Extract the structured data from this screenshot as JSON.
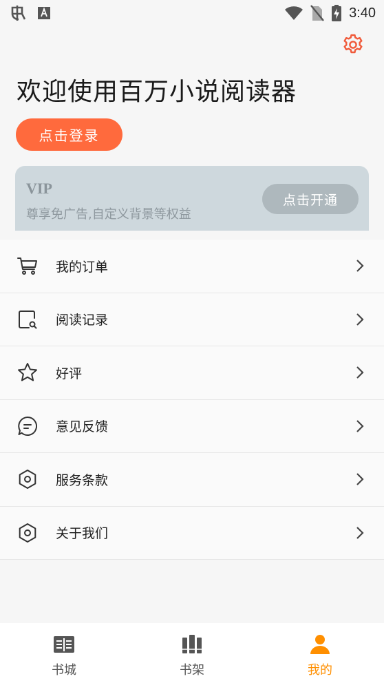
{
  "status_bar": {
    "time": "3:40"
  },
  "header": {
    "welcome_text": "欢迎使用百万小说阅读器",
    "login_label": "点击登录"
  },
  "vip": {
    "title": "VIP",
    "description": "尊享免广告,自定义背景等权益",
    "open_label": "点击开通"
  },
  "menu": {
    "items": [
      {
        "label": "我的订单",
        "icon": "cart-icon"
      },
      {
        "label": "阅读记录",
        "icon": "reading-history-icon"
      },
      {
        "label": "好评",
        "icon": "star-icon"
      },
      {
        "label": "意见反馈",
        "icon": "feedback-icon"
      },
      {
        "label": "服务条款",
        "icon": "hexagon-icon"
      },
      {
        "label": "关于我们",
        "icon": "hexagon-icon"
      }
    ]
  },
  "tabbar": {
    "tabs": [
      {
        "label": "书城",
        "icon": "bookstore-icon",
        "active": false
      },
      {
        "label": "书架",
        "icon": "bookshelf-icon",
        "active": false
      },
      {
        "label": "我的",
        "icon": "profile-icon",
        "active": true
      }
    ]
  },
  "colors": {
    "accent": "#ff6a3d",
    "active_tab": "#ff8f00",
    "vip_card": "#ced8dd"
  }
}
